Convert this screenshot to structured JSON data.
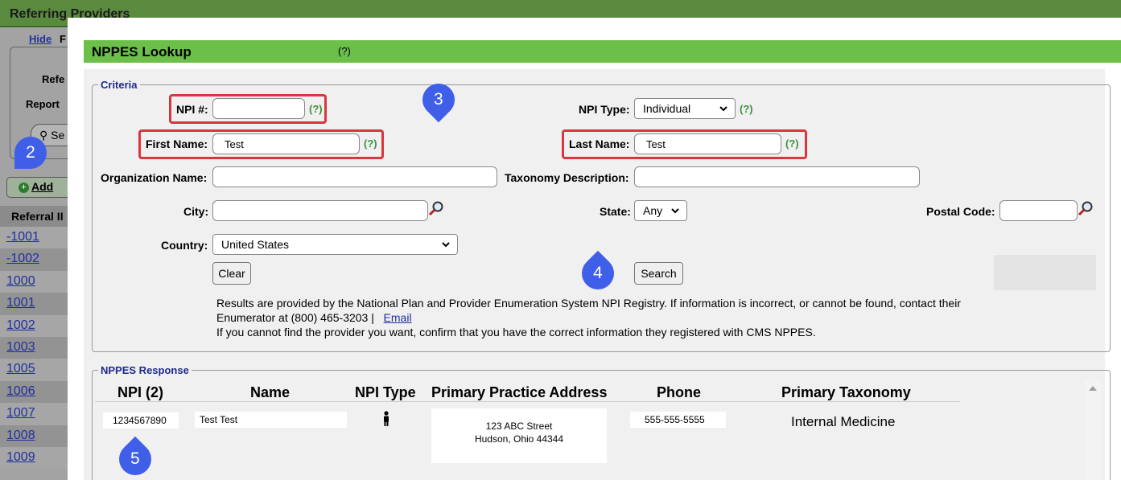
{
  "background": {
    "title": "Referring Providers",
    "hide_link": "Hide",
    "f_fragment": "F",
    "referring_fragment": "Refe",
    "report_fragment": "Report",
    "search_fragment": "Se",
    "add_label": "Add",
    "column_header": "Referral II",
    "rows": [
      "-1001",
      "-1002",
      "1000",
      "1001",
      "1002",
      "1003",
      "1005",
      "1006",
      "1007",
      "1008",
      "1009"
    ]
  },
  "modal": {
    "title": "NPPES Lookup",
    "help": "(?)",
    "criteria": {
      "legend": "Criteria",
      "npi_label": "NPI #:",
      "npi_value": "",
      "npi_type_label": "NPI Type:",
      "npi_type_value": "Individual",
      "first_name_label": "First Name:",
      "first_name_value": "Test",
      "last_name_label": "Last Name:",
      "last_name_value": "Test",
      "org_name_label": "Organization Name:",
      "org_name_value": "",
      "taxonomy_label": "Taxonomy Description:",
      "taxonomy_value": "",
      "city_label": "City:",
      "city_value": "",
      "state_label": "State:",
      "state_value": "Any",
      "postal_label": "Postal Code:",
      "postal_value": "",
      "country_label": "Country:",
      "country_value": "United States",
      "clear_label": "Clear",
      "search_label": "Search",
      "help": "(?)",
      "note_line1": "Results are provided by the National Plan and Provider Enumeration System NPI Registry. If information is incorrect, or cannot be found, contact their",
      "note_line2": "Enumerator at (800) 465-3203 |",
      "email_link": "Email",
      "note_line3": "If you cannot find the provider you want, confirm that you have the correct information they registered with CMS NPPES."
    },
    "response": {
      "legend": "NPPES Response",
      "headers": [
        "NPI (2)",
        "Name",
        "NPI Type",
        "Primary Practice Address",
        "Phone",
        "Primary Taxonomy"
      ],
      "row": {
        "npi": "1234567890",
        "name": "Test Test",
        "npi_type_icon": "person-icon",
        "address_line1": "123 ABC Street",
        "address_line2": "Hudson, Ohio 44344",
        "phone": "555-555-5555",
        "taxonomy": "Internal Medicine"
      }
    }
  },
  "markers": [
    "2",
    "3",
    "4",
    "5"
  ],
  "colors": {
    "title_green": "#6cbf48",
    "highlight_red": "#d9363e",
    "marker_blue": "#3f5fe8",
    "link_blue": "#1f2f9f"
  }
}
